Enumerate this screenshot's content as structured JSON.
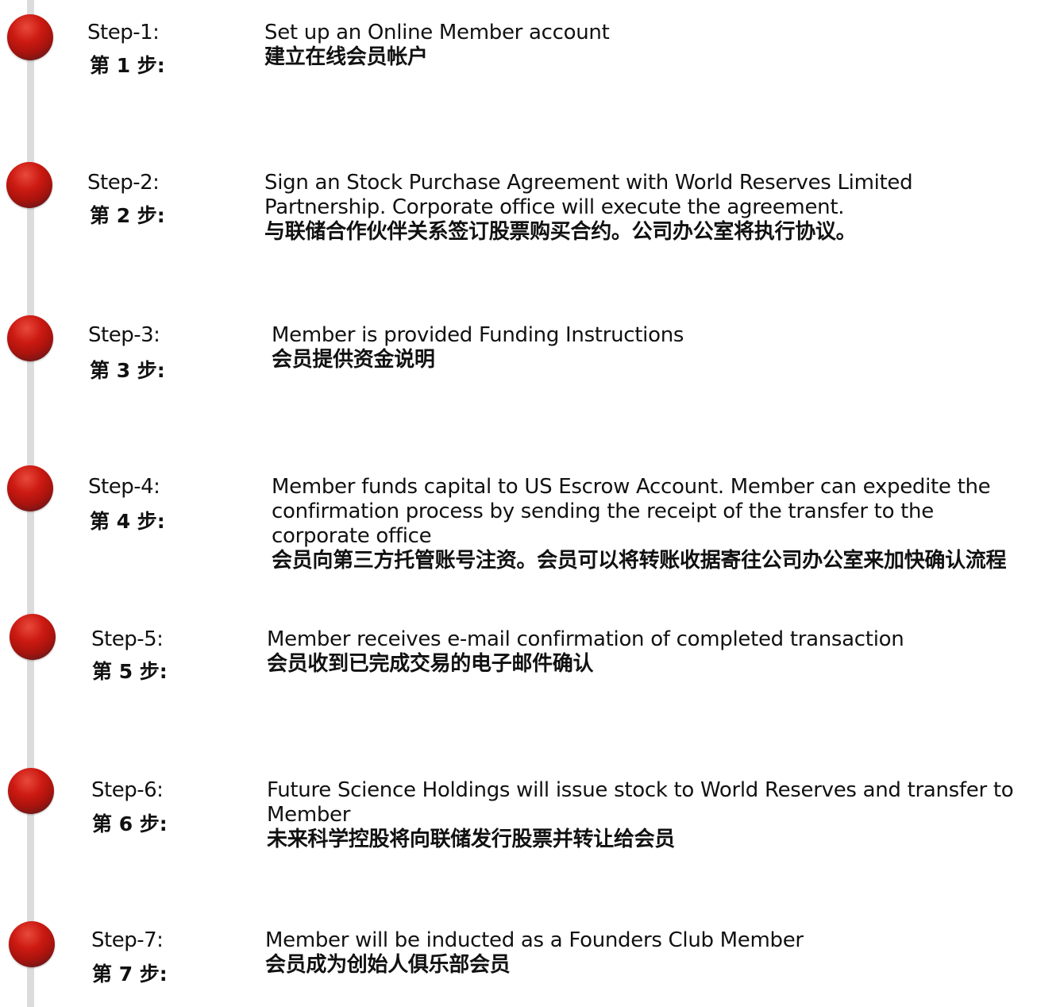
{
  "colors": {
    "dot": "#b5140e",
    "line": "#dcdcdc",
    "text": "#111111"
  },
  "steps": [
    {
      "label_en": "Step-1:",
      "label_zh": "第 1 步:",
      "desc_en": "Set up an Online Member account",
      "desc_zh": "建立在线会员帐户"
    },
    {
      "label_en": "Step-2:",
      "label_zh": "第 2 步:",
      "desc_en": "Sign an Stock Purchase Agreement with World Reserves Limited Partnership. Corporate office will execute the agreement.",
      "desc_zh": "与联储合作伙伴关系签订股票购买合约。公司办公室将执行协议。"
    },
    {
      "label_en": "Step-3:",
      "label_zh": "第 3 步:",
      "desc_en": "Member is provided Funding Instructions",
      "desc_zh": "会员提供资金说明"
    },
    {
      "label_en": "Step-4:",
      "label_zh": "第 4 步:",
      "desc_en": "Member funds capital to US Escrow Account. Member can expedite the confirmation process by sending the receipt of the transfer to the corporate office",
      "desc_zh": "会员向第三方托管账号注资。会员可以将转账收据寄往公司办公室来加快确认流程"
    },
    {
      "label_en": "Step-5:",
      "label_zh": "第 5 步:",
      "desc_en": "Member receives e-mail confirmation of completed transaction",
      "desc_zh": "会员收到已完成交易的电子邮件确认"
    },
    {
      "label_en": "Step-6:",
      "label_zh": "第 6 步:",
      "desc_en": "Future Science Holdings will issue stock to World Reserves and transfer to Member",
      "desc_zh": "未来科学控股将向联储发行股票并转让给会员"
    },
    {
      "label_en": "Step-7:",
      "label_zh": "第 7 步:",
      "desc_en": "Member will be inducted as a Founders Club Member",
      "desc_zh": "会员成为创始人俱乐部会员"
    }
  ]
}
